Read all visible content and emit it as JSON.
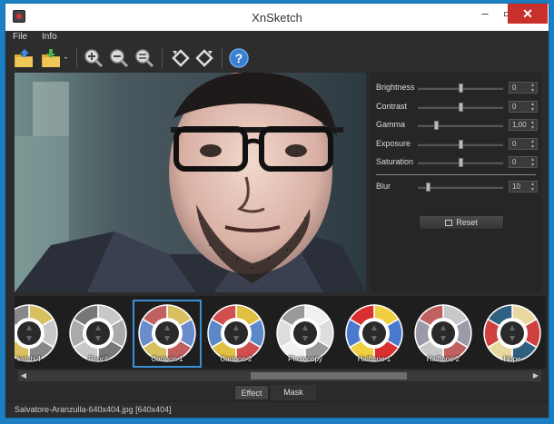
{
  "window": {
    "title": "XnSketch"
  },
  "menu": [
    "File",
    "Info"
  ],
  "toolbar": {
    "buttons": [
      "open-icon",
      "save-icon",
      "zoom-in-icon",
      "zoom-fit-icon",
      "zoom-out-icon",
      "rotate-left-icon",
      "rotate-right-icon",
      "help-icon"
    ]
  },
  "adjustments": [
    {
      "label": "Brightness",
      "value": "0",
      "level": 0.5
    },
    {
      "label": "Contrast",
      "value": "0",
      "level": 0.5
    },
    {
      "label": "Gamma",
      "value": "1,00",
      "level": 0.2
    },
    {
      "label": "Exposure",
      "value": "0",
      "level": 0.5
    },
    {
      "label": "Saturation",
      "value": "0",
      "level": 0.5
    }
  ],
  "blur": {
    "label": "Blur",
    "value": "10",
    "level": 0.1
  },
  "reset_label": "Reset",
  "effects": [
    {
      "label": "ketch 4",
      "colors": [
        "#d8c060",
        "#c8c8c8",
        "#888"
      ]
    },
    {
      "label": "Pencil",
      "colors": [
        "#c8c8c8",
        "#aaaaaa",
        "#777"
      ]
    },
    {
      "label": "Cartoon 1",
      "colors": [
        "#d8c060",
        "#6a8cc8",
        "#c06060"
      ],
      "selected": true
    },
    {
      "label": "Cartoon 2",
      "colors": [
        "#e0c040",
        "#5a88c8",
        "#d05050"
      ]
    },
    {
      "label": "Photocopy",
      "colors": [
        "#f0f0f0",
        "#dddddd",
        "#999"
      ]
    },
    {
      "label": "Halftone 1",
      "colors": [
        "#f0d040",
        "#4a7ad0",
        "#d83030"
      ]
    },
    {
      "label": "Halftone 2",
      "colors": [
        "#c8c8c8",
        "#9a9aa8",
        "#c06060"
      ]
    },
    {
      "label": "Hope",
      "colors": [
        "#e8d8a0",
        "#d04040",
        "#306080"
      ]
    }
  ],
  "tabs": {
    "effect": "Effect",
    "mask": "Mask"
  },
  "status": "Salvatore-Aranzulla-640x404.jpg [640x404]",
  "accent": "#3c8fd6"
}
